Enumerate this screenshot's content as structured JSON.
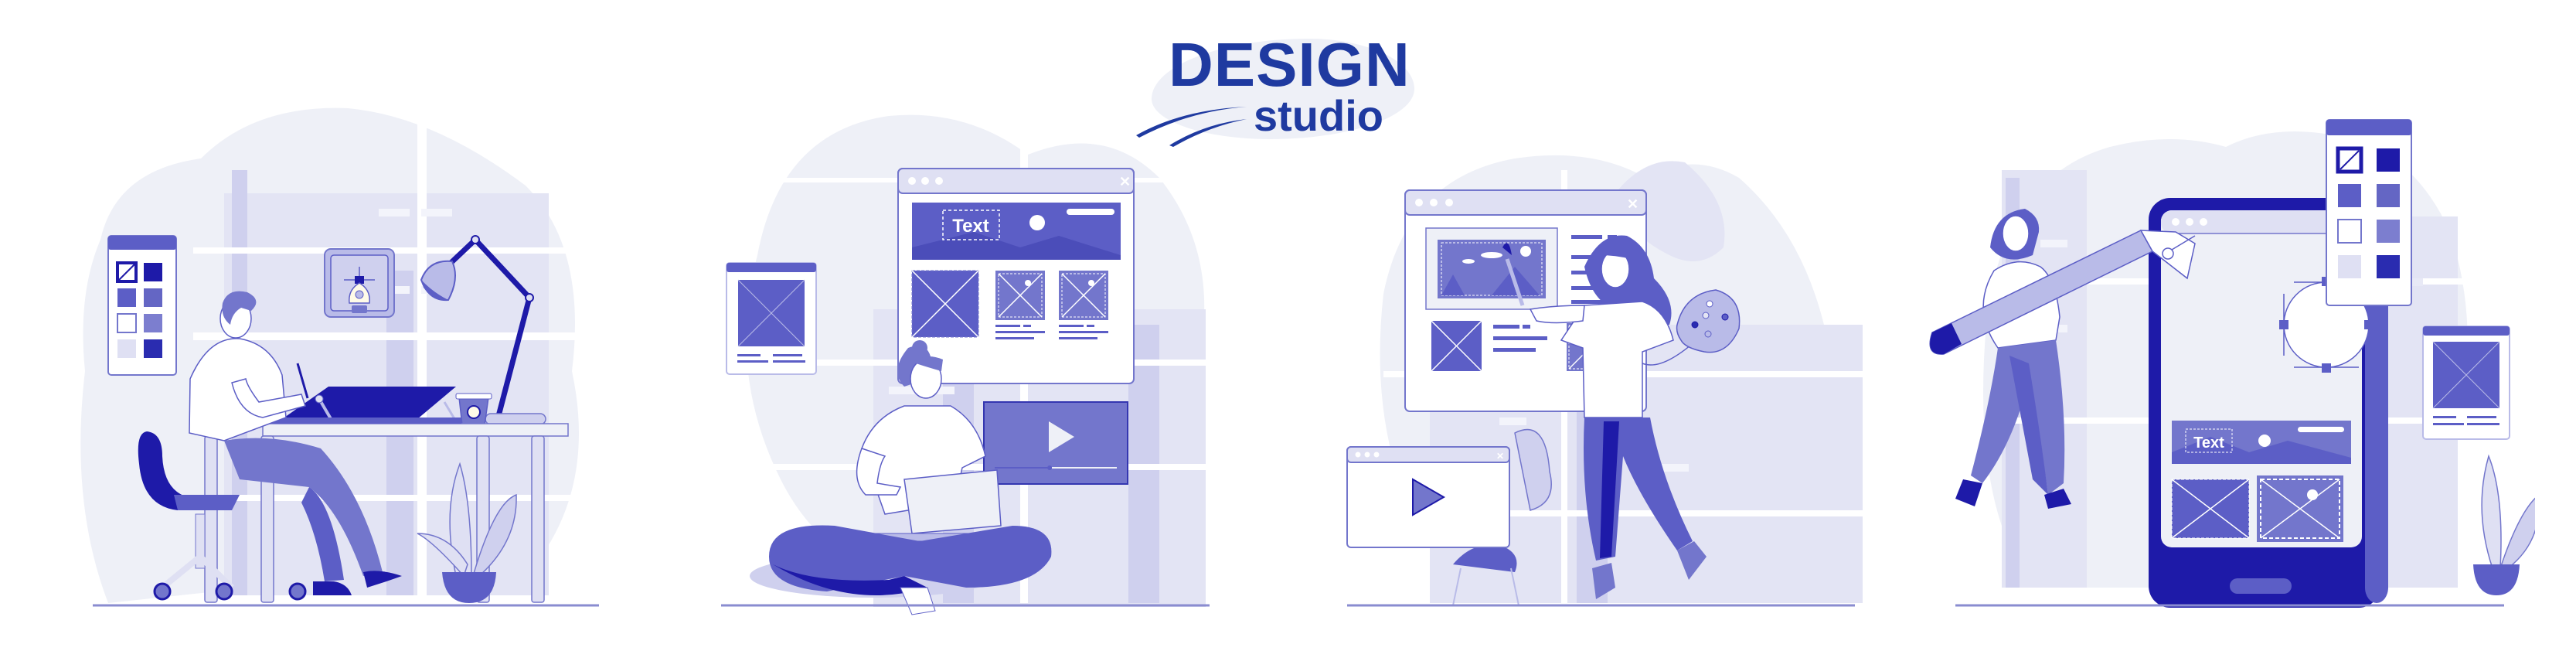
{
  "logo": {
    "title": "DESIGN",
    "subtitle": "studio"
  },
  "colors": {
    "brand_dark": "#1f3aa0",
    "primary": "#5c5ec6",
    "primary_mid": "#7376cc",
    "primary_light": "#b9bbe8",
    "primary_pale": "#dfe0f3",
    "background_blob": "#eef0f7",
    "deep_indigo": "#1e1aa8",
    "white": "#ffffff"
  },
  "scenes": [
    {
      "id": "drafting-table",
      "description": "Designer drawing on a tilted drafting table",
      "swatch_panel": true
    },
    {
      "id": "laptop-wireframe",
      "description": "Woman sitting cross-legged with laptop, web wireframe and video player behind",
      "browser_text_label": "Text",
      "video_progress": 0.45
    },
    {
      "id": "painting-wireframe",
      "description": "Woman with brush and palette painting a web layout",
      "palette_colors": [
        "#ffffff",
        "#e4e5f4",
        "#5c5ec6",
        "#2a2cb0",
        "#b9bbe8"
      ]
    },
    {
      "id": "mobile-design",
      "description": "Woman carrying giant pen tool next to a smartphone mockup",
      "phone_text_label": "Text",
      "swatch_panel": true
    }
  ]
}
